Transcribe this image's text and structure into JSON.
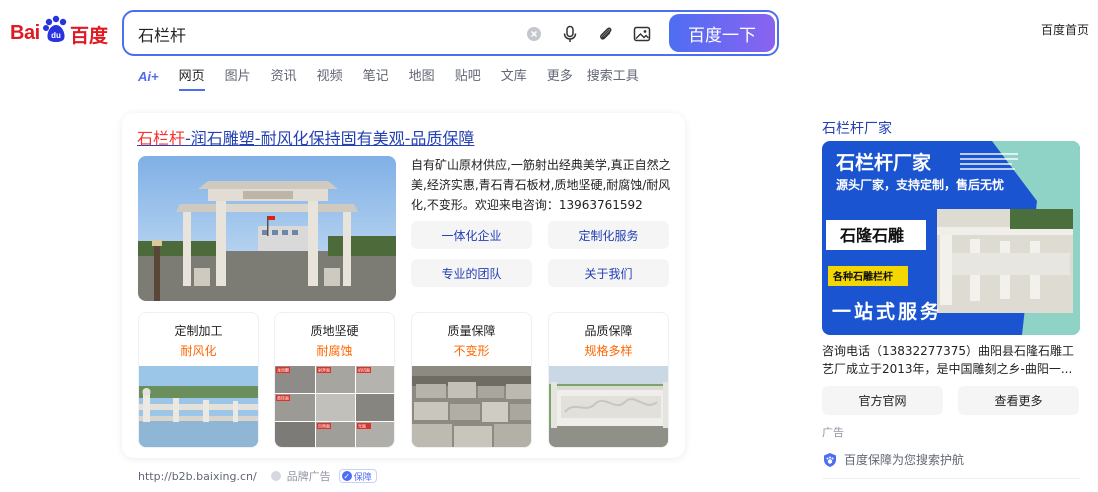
{
  "logo": {
    "bai": "Bai",
    "du": "du",
    "cn": "百度"
  },
  "search": {
    "query": "石栏杆",
    "button": "百度一下"
  },
  "header": {
    "home_link": "百度首页"
  },
  "tabs": [
    {
      "label": "Ai+",
      "active": false
    },
    {
      "label": "网页",
      "active": true
    },
    {
      "label": "图片",
      "active": false
    },
    {
      "label": "资讯",
      "active": false
    },
    {
      "label": "视频",
      "active": false
    },
    {
      "label": "笔记",
      "active": false
    },
    {
      "label": "地图",
      "active": false
    },
    {
      "label": "贴吧",
      "active": false
    },
    {
      "label": "文库",
      "active": false
    },
    {
      "label": "更多",
      "active": false
    },
    {
      "label": "搜索工具",
      "active": false
    }
  ],
  "result": {
    "title_highlight": "石栏杆",
    "title_rest": "-润石雕塑-耐风化保持固有美观-品质保障",
    "description": "自有矿山原材供应,一筋射出经典美学,真正自然之美,经济实惠,青石青石板材,质地坚硬,耐腐蚀/耐风化,不变形。欢迎来电咨询：13963761592",
    "services": [
      "一体化企业",
      "定制化服务",
      "专业的团队",
      "关于我们"
    ],
    "features": [
      {
        "title": "定制加工",
        "sub": "耐风化"
      },
      {
        "title": "质地坚硬",
        "sub": "耐腐蚀"
      },
      {
        "title": "质量保障",
        "sub": "不变形"
      },
      {
        "title": "品质保障",
        "sub": "规格多样"
      }
    ],
    "collage_labels": [
      "龙凤雕",
      "剁斧面",
      "机切面",
      "荔枝面",
      "自然面",
      "光面"
    ],
    "source_url": "http://b2b.baixing.cn/",
    "ad_label": "品牌广告",
    "guarantee_badge": "保障"
  },
  "sidebar": {
    "title": "石栏杆厂家",
    "ad_image": {
      "headline": "石栏杆厂家",
      "subline": "源头厂家，支持定制，售后无忧",
      "brand": "石隆石雕",
      "tag": "各种石雕栏杆",
      "slogan": "一站式服务"
    },
    "description": "咨询电话（13832277375）曲阳县石隆石雕工艺厂成立于2013年，是中国雕刻之乡-曲阳一...",
    "buttons": [
      "官方官网",
      "查看更多"
    ],
    "ad_label": "广告",
    "guarantee": "百度保障为您搜索护航"
  },
  "colors": {
    "brand_blue": "#4e6ef2",
    "link": "#2440b3",
    "highlight_red": "#f73131",
    "orange": "#ff6600",
    "baidu_red": "#de1b24"
  }
}
